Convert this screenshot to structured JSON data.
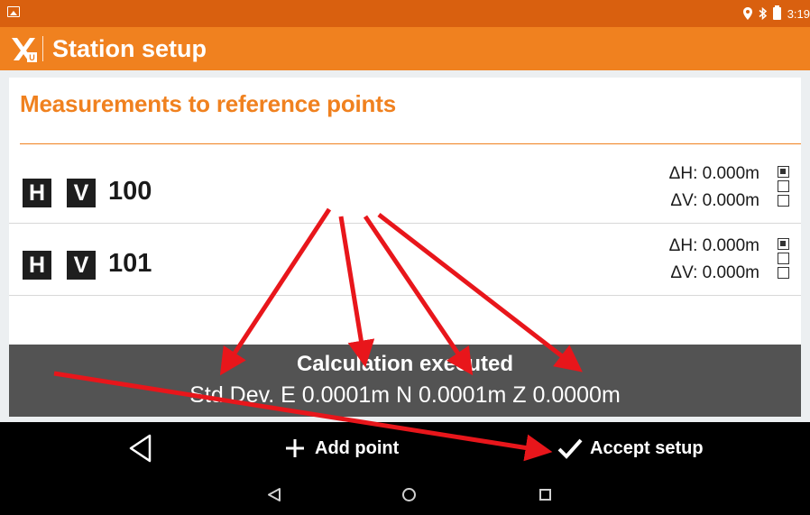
{
  "status_bar": {
    "time": "3:19",
    "icons": [
      "image-notification-icon",
      "location-icon",
      "bluetooth-icon",
      "battery-icon"
    ]
  },
  "app_bar": {
    "title": "Station setup",
    "logo_icon": "x-pad-logo-icon",
    "color": "#f0811f"
  },
  "section": {
    "title": "Measurements to reference points"
  },
  "points": [
    {
      "h_badge": "H",
      "v_badge": "V",
      "name": "100",
      "delta_h": "ΔH: 0.000m",
      "delta_v": "ΔV: 0.000m",
      "checks": [
        true,
        false,
        false
      ]
    },
    {
      "h_badge": "H",
      "v_badge": "V",
      "name": "101",
      "delta_h": "ΔH: 0.000m",
      "delta_v": "ΔV: 0.000m",
      "checks": [
        true,
        false,
        false
      ]
    }
  ],
  "toast": {
    "title": "Calculation executed",
    "message": "Std.Dev. E 0.0001m N 0.0001m Z 0.0000m"
  },
  "actions": {
    "back_icon": "back-triangle-icon",
    "add_label": "Add point",
    "add_icon": "plus-icon",
    "accept_label": "Accept setup",
    "accept_icon": "checkmark-icon"
  },
  "nav": {
    "icons": [
      "nav-back-icon",
      "nav-home-icon",
      "nav-recent-icon"
    ]
  },
  "annotation_color": "#e8161b"
}
